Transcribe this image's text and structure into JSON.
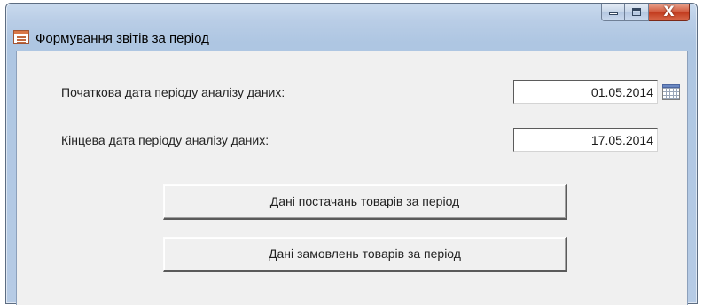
{
  "window": {
    "title": "Формування звітів за період",
    "caption_buttons": {
      "minimize_icon": "minimize-icon",
      "maximize_icon": "maximize-icon",
      "close_icon": "close-icon",
      "close_glyph": "X"
    }
  },
  "form": {
    "start_date_label": "Початкова дата періоду аналізу даних:",
    "start_date_value": "01.05.2014",
    "end_date_label": "Кінцева дата періоду аналізу даних:",
    "end_date_value": "17.05.2014",
    "calendar_icon": "calendar-icon"
  },
  "buttons": {
    "supplies_label": "Дані постачань товарів за період",
    "orders_label": "Дані замовлень товарів за період"
  },
  "colors": {
    "title_bar": "#b9cde6",
    "client_background": "#f0f0f0",
    "close_button": "#c1391c"
  }
}
